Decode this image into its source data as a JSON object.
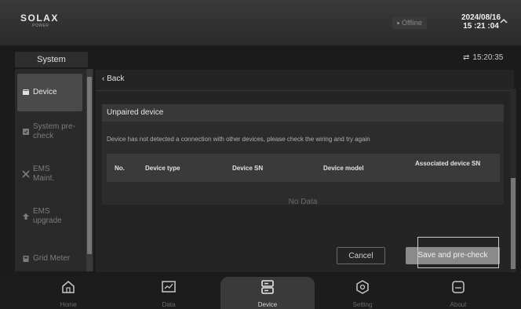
{
  "header": {
    "logo": "SOLAX",
    "logo_sub": "POWER",
    "status": "Offline",
    "date": "2024/08/16",
    "time": "15 :21 :04"
  },
  "system_tab": {
    "label": "System"
  },
  "refresh_time": "15:20:35",
  "sidebar": {
    "items": [
      {
        "label": "Device",
        "icon": "device-icon"
      },
      {
        "label": "System pre-check",
        "icon": "checklist-icon"
      },
      {
        "label": "EMS Maint.",
        "icon": "wrench-icon"
      },
      {
        "label": "EMS upgrade",
        "icon": "upload-icon"
      },
      {
        "label": "Grid Meter",
        "icon": "meter-icon"
      }
    ]
  },
  "main": {
    "back_label": "Back",
    "panel_title": "Unpaired device",
    "message": "Device has not detected a connection with other devices, please check the wiring and try again",
    "columns": [
      "No.",
      "Device type",
      "Device SN",
      "Device model",
      "Associated device SN"
    ],
    "no_data": "No Data",
    "cancel_label": "Cancel",
    "save_label": "Save and pre-check"
  },
  "bottom_nav": [
    {
      "label": "Home",
      "icon": "home-icon"
    },
    {
      "label": "Data",
      "icon": "chart-icon"
    },
    {
      "label": "Device",
      "icon": "device-stack-icon",
      "active": true
    },
    {
      "label": "Setting",
      "icon": "settings-icon"
    },
    {
      "label": "About",
      "icon": "about-icon"
    }
  ]
}
